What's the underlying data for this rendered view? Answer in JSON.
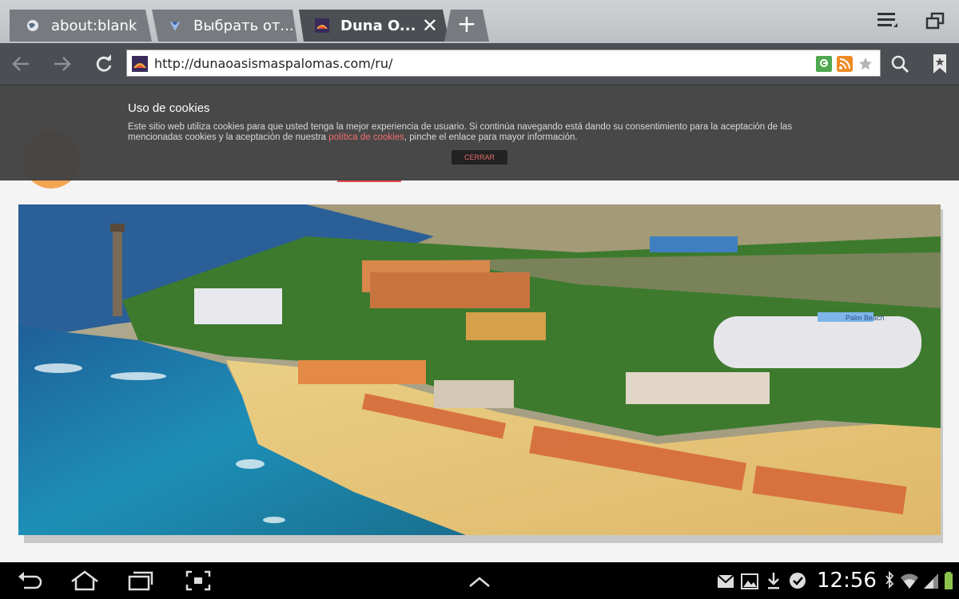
{
  "browser": {
    "tabs": [
      {
        "title": "about:blank",
        "icon": "globe-icon",
        "active": false
      },
      {
        "title": "Выбрать от...",
        "icon": "app-icon",
        "active": false
      },
      {
        "title": "Duna O...",
        "icon": "site-favicon",
        "active": true
      }
    ],
    "new_tab_symbol": "+",
    "close_symbol": "✕",
    "url": "http://dunaoasismaspalomas.com/ru/"
  },
  "cookie_notice": {
    "title": "Uso de cookies",
    "text_before_link": "Este sitio web utiliza cookies para que usted tenga la mejor experiencia de usuario. Si continúa navegando está dando su consentimiento para la aceptación de las mencionadas cookies y la aceptación de nuestra ",
    "link_text": "política de cookies",
    "text_after_link": ", pinche el enlace para mayor información.",
    "button": "CERRAR"
  },
  "hero": {
    "building_sign": "Palm Beach"
  },
  "statusbar": {
    "time": "12:56"
  },
  "colors": {
    "tab_active": "#4b4e52",
    "tab_inactive": "#777a7e",
    "cookie_link": "#f26d6d",
    "logo_orange": "#f3a452",
    "nav_accent": "#e24b4b"
  }
}
